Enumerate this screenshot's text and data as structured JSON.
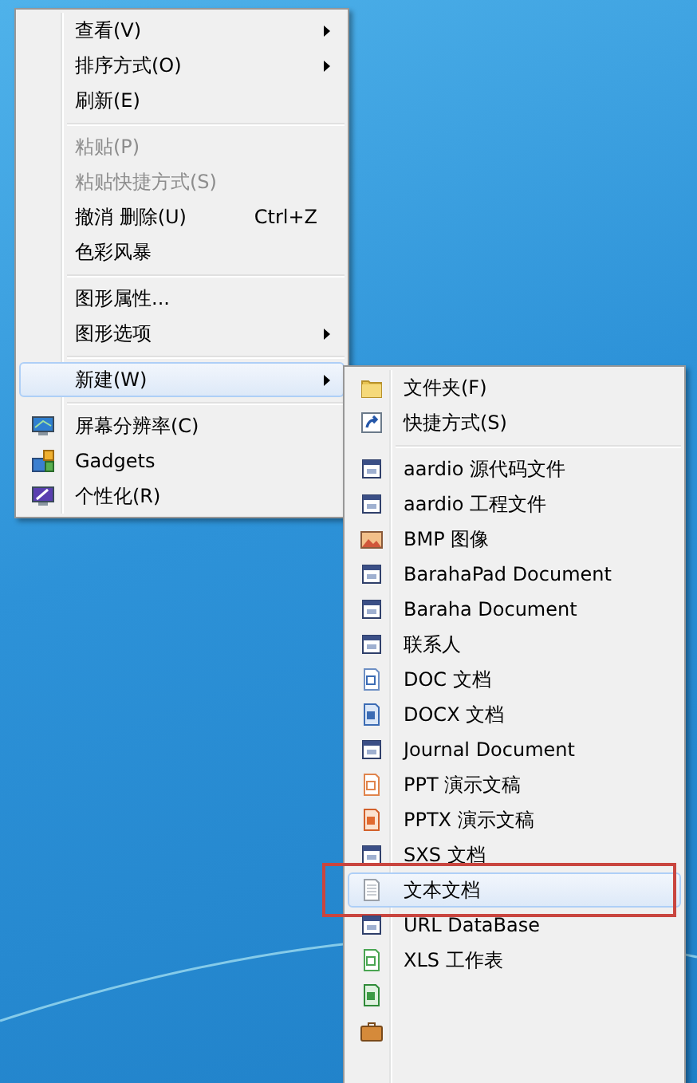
{
  "context_menu": {
    "items": [
      {
        "kind": "plain",
        "label": "查看(V)",
        "submenu": true,
        "disabled": false,
        "selected": false
      },
      {
        "kind": "plain",
        "label": "排序方式(O)",
        "submenu": true,
        "disabled": false,
        "selected": false
      },
      {
        "kind": "plain",
        "label": "刷新(E)",
        "submenu": false,
        "disabled": false,
        "selected": false
      },
      {
        "kind": "separator"
      },
      {
        "kind": "plain",
        "label": "粘贴(P)",
        "submenu": false,
        "disabled": true,
        "selected": false
      },
      {
        "kind": "plain",
        "label": "粘贴快捷方式(S)",
        "submenu": false,
        "disabled": true,
        "selected": false
      },
      {
        "kind": "plain",
        "label": "撤消 删除(U)",
        "shortcut": "Ctrl+Z",
        "submenu": false,
        "disabled": false,
        "selected": false
      },
      {
        "kind": "plain",
        "label": "色彩风暴",
        "submenu": false,
        "disabled": false,
        "selected": false
      },
      {
        "kind": "separator"
      },
      {
        "kind": "plain",
        "label": "图形属性...",
        "submenu": false,
        "disabled": false,
        "selected": false
      },
      {
        "kind": "plain",
        "label": "图形选项",
        "submenu": true,
        "disabled": false,
        "selected": false
      },
      {
        "kind": "separator"
      },
      {
        "kind": "plain",
        "label": "新建(W)",
        "submenu": true,
        "disabled": false,
        "selected": true
      },
      {
        "kind": "separator"
      },
      {
        "kind": "monitor",
        "label": "屏幕分辨率(C)",
        "submenu": false,
        "disabled": false,
        "selected": false
      },
      {
        "kind": "gadgets",
        "label": "Gadgets",
        "submenu": false,
        "disabled": false,
        "selected": false
      },
      {
        "kind": "personalize",
        "label": "个性化(R)",
        "submenu": false,
        "disabled": false,
        "selected": false
      }
    ]
  },
  "new_submenu": {
    "items": [
      {
        "kind": "folder",
        "label": "文件夹(F)",
        "selected": false,
        "annotated": false
      },
      {
        "kind": "shortcut",
        "label": "快捷方式(S)",
        "selected": false,
        "annotated": false
      },
      {
        "kind": "separator"
      },
      {
        "kind": "app",
        "label": "aardio 源代码文件",
        "selected": false,
        "annotated": false
      },
      {
        "kind": "app",
        "label": "aardio 工程文件",
        "selected": false,
        "annotated": false
      },
      {
        "kind": "image",
        "label": "BMP 图像",
        "selected": false,
        "annotated": false
      },
      {
        "kind": "app",
        "label": "BarahaPad Document",
        "selected": false,
        "annotated": false
      },
      {
        "kind": "app",
        "label": "Baraha Document",
        "selected": false,
        "annotated": false
      },
      {
        "kind": "app",
        "label": "联系人",
        "selected": false,
        "annotated": false
      },
      {
        "kind": "doc",
        "label": "DOC 文档",
        "selected": false,
        "annotated": false
      },
      {
        "kind": "docx",
        "label": "DOCX 文档",
        "selected": false,
        "annotated": false
      },
      {
        "kind": "app",
        "label": "Journal Document",
        "selected": false,
        "annotated": false
      },
      {
        "kind": "ppt",
        "label": "PPT 演示文稿",
        "selected": false,
        "annotated": false
      },
      {
        "kind": "pptx",
        "label": "PPTX 演示文稿",
        "selected": false,
        "annotated": false
      },
      {
        "kind": "app",
        "label": "SXS 文档",
        "selected": false,
        "annotated": false
      },
      {
        "kind": "text",
        "label": "文本文档",
        "selected": true,
        "annotated": true
      },
      {
        "kind": "app",
        "label": "URL DataBase",
        "selected": false,
        "annotated": false
      },
      {
        "kind": "xls",
        "label": "XLS 工作表",
        "selected": false,
        "annotated": false
      },
      {
        "kind": "xlsx",
        "selected": false,
        "annotated": false
      },
      {
        "kind": "briefcase",
        "selected": false,
        "annotated": false
      }
    ]
  }
}
